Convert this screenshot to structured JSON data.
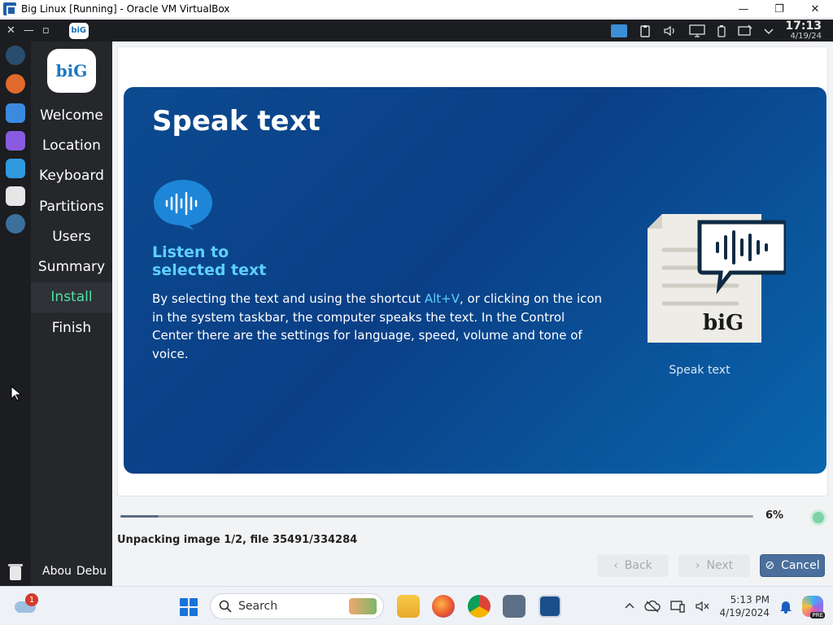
{
  "window": {
    "title": "Big Linux [Running] - Oracle VM VirtualBox",
    "controls": {
      "minimize": "—",
      "maximize": "❐",
      "close": "✕"
    }
  },
  "guest_panel": {
    "left_glyphs": {
      "close": "✕",
      "min": "—",
      "restore": "▫"
    },
    "logo": "biG",
    "time": "17:13",
    "date": "4/19/24"
  },
  "installer": {
    "logo": "biG",
    "steps": [
      {
        "label": "Welcome",
        "active": false
      },
      {
        "label": "Location",
        "active": false
      },
      {
        "label": "Keyboard",
        "active": false
      },
      {
        "label": "Partitions",
        "active": false
      },
      {
        "label": "Users",
        "active": false
      },
      {
        "label": "Summary",
        "active": false
      },
      {
        "label": "Install",
        "active": true
      },
      {
        "label": "Finish",
        "active": false
      }
    ],
    "bottom_links": {
      "about": "Abou",
      "debug": "Debu"
    }
  },
  "slide": {
    "title": "Speak text",
    "subtitle_line1": "Listen to",
    "subtitle_line2": "selected text",
    "desc_before": "By selecting the text and using the shortcut ",
    "desc_shortcut": "Alt+V",
    "desc_after": ", or clicking on the icon in the system taskbar, the computer speaks the text. In the Control Center there are the settings for language, speed, volume and tone of voice.",
    "illustration_logo": "biG",
    "caption": "Speak text"
  },
  "progress": {
    "fraction": 0.06,
    "percent_label": "6%",
    "status": "Unpacking image 1/2, file 35491/334284"
  },
  "buttons": {
    "back": {
      "label": "Back",
      "glyph": "‹",
      "enabled": false
    },
    "next": {
      "label": "Next",
      "glyph": "›",
      "enabled": false
    },
    "cancel": {
      "label": "Cancel",
      "glyph": "⊘",
      "enabled": true
    }
  },
  "taskbar": {
    "weather_badge": "1",
    "search_placeholder": "Search",
    "time": "5:13 PM",
    "date": "4/19/2024",
    "copilot_badge": "PRE"
  },
  "colors": {
    "accent_green": "#4fe0a5",
    "slide_blue": "#0c4a8f",
    "highlight_cyan": "#5ed0ff",
    "cancel_button": "#4a6f9c"
  }
}
